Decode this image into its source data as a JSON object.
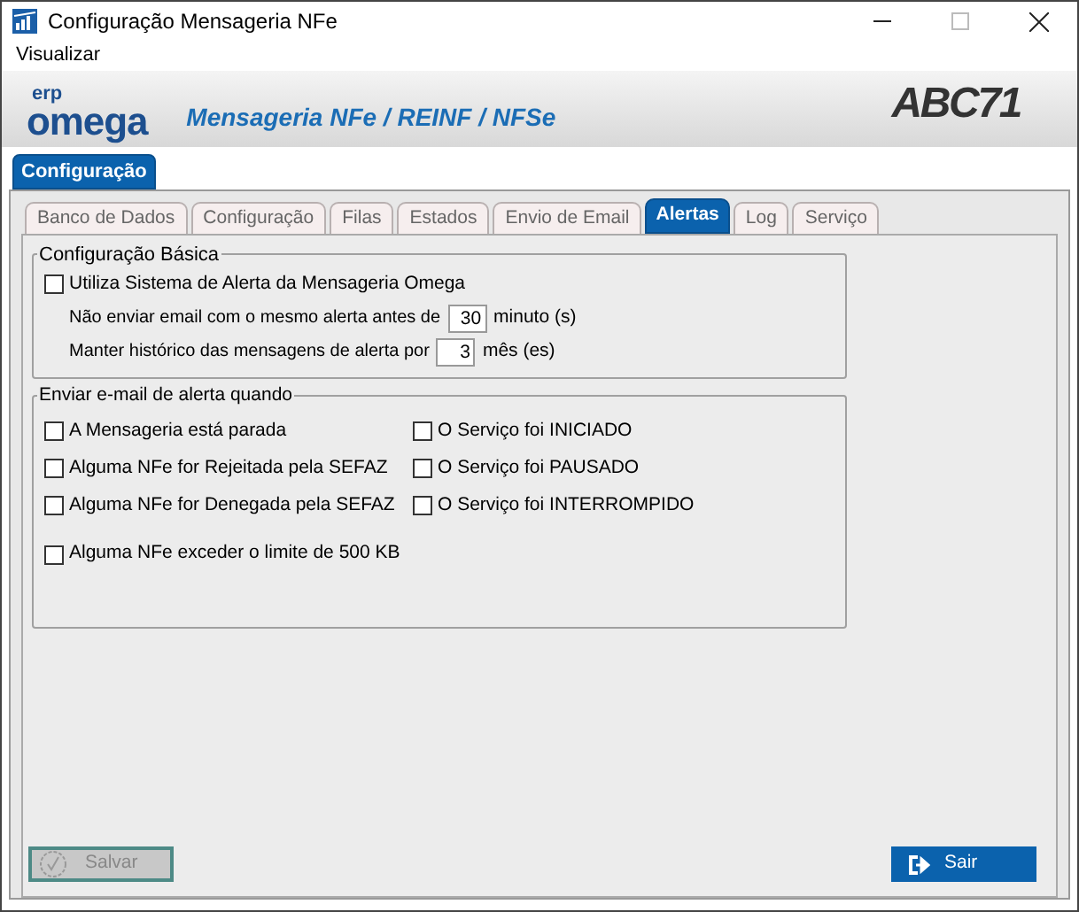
{
  "window": {
    "title": "Configuração Mensageria NFe"
  },
  "menu": [
    "Visualizar"
  ],
  "header": {
    "logo_top": "erp",
    "logo_bottom": "omega",
    "subtitle": "Mensageria NFe / REINF / NFSe",
    "brand": "ABC71"
  },
  "outer_tabs": [
    {
      "label": "Configuração",
      "selected": true
    }
  ],
  "tabs": [
    {
      "label": "Banco de Dados",
      "selected": false
    },
    {
      "label": "Configuração",
      "selected": false
    },
    {
      "label": "Filas",
      "selected": false
    },
    {
      "label": "Estados",
      "selected": false
    },
    {
      "label": "Envio de Email",
      "selected": false
    },
    {
      "label": "Alertas",
      "selected": true
    },
    {
      "label": "Log",
      "selected": false
    },
    {
      "label": "Serviço",
      "selected": false
    }
  ],
  "basic": {
    "title": "Configuração Básica",
    "use_alerts": {
      "label": "Utiliza Sistema de Alerta da Mensageria Omega",
      "checked": false
    },
    "fields": [
      {
        "label": "Não enviar email com o mesmo alerta antes de",
        "value": "30",
        "unit": "minuto (s)"
      },
      {
        "label": "Manter histórico das mensagens de alerta por",
        "value": "3",
        "unit": "mês (es)"
      }
    ]
  },
  "alerts": {
    "title": "Enviar e-mail de alerta quando",
    "left": [
      {
        "label": "A Mensageria está parada",
        "checked": false
      },
      {
        "label": "Alguma NFe for Rejeitada pela SEFAZ",
        "checked": false
      },
      {
        "label": "Alguma NFe for Denegada pela SEFAZ",
        "checked": false
      }
    ],
    "right": [
      {
        "label": "O Serviço foi INICIADO",
        "checked": false
      },
      {
        "label": "O Serviço foi PAUSADO",
        "checked": false
      },
      {
        "label": "O Serviço foi INTERROMPIDO",
        "checked": false
      }
    ],
    "bottom": [
      {
        "label": "Alguma NFe exceder o limite de 500 KB",
        "checked": false
      }
    ]
  },
  "buttons": [
    {
      "label": "Salvar",
      "disabled": true
    },
    {
      "label": "Sair",
      "disabled": false
    }
  ]
}
